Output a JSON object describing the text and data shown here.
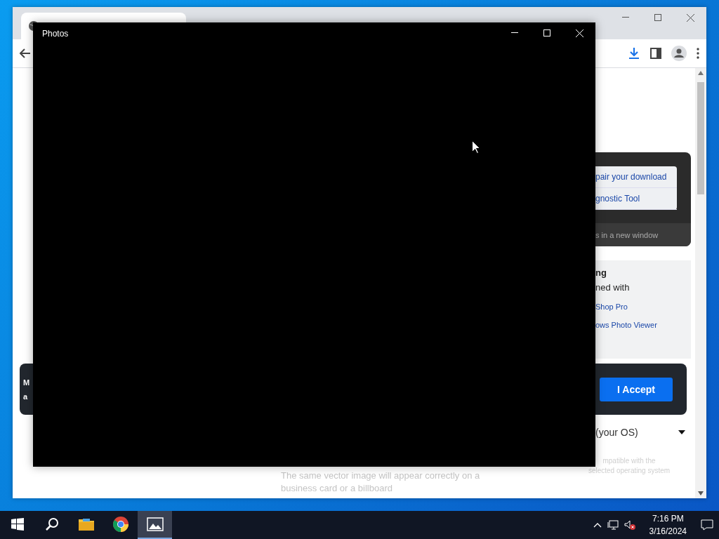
{
  "photos_window": {
    "title": "Photos"
  },
  "browser": {
    "download_card": {
      "links": [
        "pair your download",
        "gnostic Tool"
      ],
      "note": "s in a new window"
    },
    "info_panel": {
      "heading": "ng",
      "text": "ned with",
      "links": [
        "Shop Pro",
        "ows Photo Viewer"
      ]
    },
    "cookie_banner": {
      "text_lines": [
        "M",
        "a"
      ],
      "button": "I Accept"
    },
    "os_select": {
      "value": "(your OS)"
    },
    "compat_note": [
      "mpatible with the",
      "selected operating system"
    ],
    "body_text": [
      "The same vector image will appear correctly on a",
      "business card or a billboard"
    ]
  },
  "taskbar": {
    "apps": [
      {
        "kind": "explorer",
        "selected": false
      },
      {
        "kind": "chrome",
        "selected": false
      },
      {
        "kind": "photos",
        "selected": true
      }
    ],
    "clock": {
      "time": "7:16 PM",
      "date": "3/16/2024"
    },
    "volume_muted": true
  }
}
